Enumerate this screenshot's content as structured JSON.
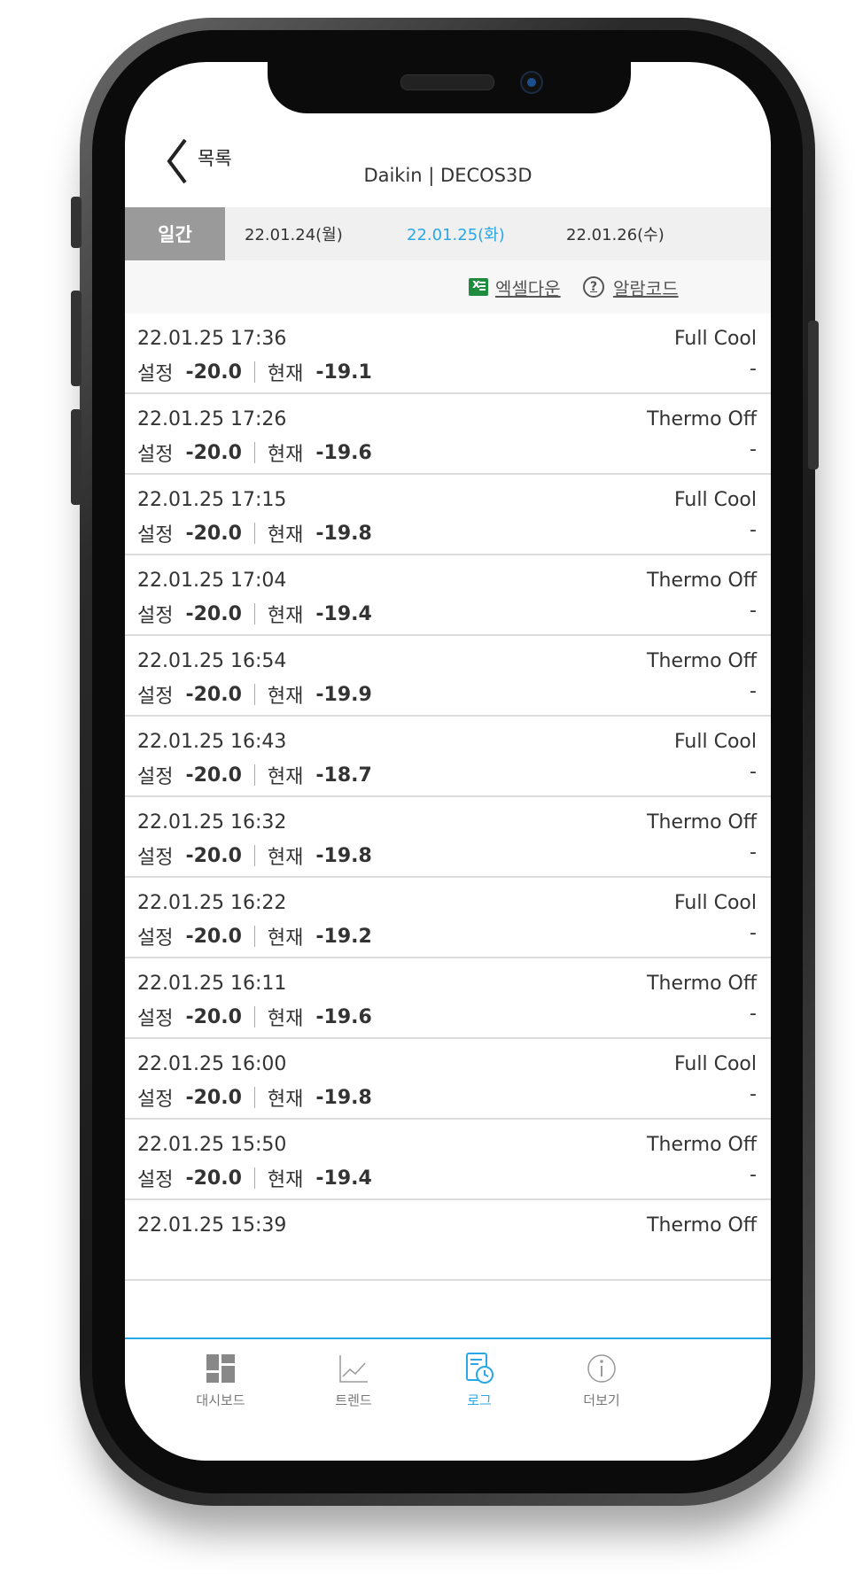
{
  "header": {
    "back_label": "목록",
    "title": "Daikin | DECOS3D"
  },
  "datebar": {
    "period_label": "일간",
    "dates": [
      "22.01.24(월)",
      "22.01.25(화)",
      "22.01.26(수)"
    ],
    "active_index": 1
  },
  "toolbar": {
    "excel_label": "엑셀다운",
    "alarm_label": "알람코드"
  },
  "labels": {
    "setpoint": "설정",
    "current": "현재"
  },
  "logs": [
    {
      "time": "22.01.25 17:36",
      "status": "Full Cool",
      "setpoint": "-20.0",
      "current": "-19.1",
      "alarm": "-"
    },
    {
      "time": "22.01.25 17:26",
      "status": "Thermo Off",
      "setpoint": "-20.0",
      "current": "-19.6",
      "alarm": "-"
    },
    {
      "time": "22.01.25 17:15",
      "status": "Full Cool",
      "setpoint": "-20.0",
      "current": "-19.8",
      "alarm": "-"
    },
    {
      "time": "22.01.25 17:04",
      "status": "Thermo Off",
      "setpoint": "-20.0",
      "current": "-19.4",
      "alarm": "-"
    },
    {
      "time": "22.01.25 16:54",
      "status": "Thermo Off",
      "setpoint": "-20.0",
      "current": "-19.9",
      "alarm": "-"
    },
    {
      "time": "22.01.25 16:43",
      "status": "Full Cool",
      "setpoint": "-20.0",
      "current": "-18.7",
      "alarm": "-"
    },
    {
      "time": "22.01.25 16:32",
      "status": "Thermo Off",
      "setpoint": "-20.0",
      "current": "-19.8",
      "alarm": "-"
    },
    {
      "time": "22.01.25 16:22",
      "status": "Full Cool",
      "setpoint": "-20.0",
      "current": "-19.2",
      "alarm": "-"
    },
    {
      "time": "22.01.25 16:11",
      "status": "Thermo Off",
      "setpoint": "-20.0",
      "current": "-19.6",
      "alarm": "-"
    },
    {
      "time": "22.01.25 16:00",
      "status": "Full Cool",
      "setpoint": "-20.0",
      "current": "-19.8",
      "alarm": "-"
    },
    {
      "time": "22.01.25 15:50",
      "status": "Thermo Off",
      "setpoint": "-20.0",
      "current": "-19.4",
      "alarm": "-"
    },
    {
      "time": "22.01.25 15:39",
      "status": "Thermo Off",
      "setpoint": "",
      "current": "",
      "alarm": ""
    }
  ],
  "nav": {
    "items": [
      "대시보드",
      "트렌드",
      "로그",
      "더보기"
    ],
    "active_index": 2
  },
  "colors": {
    "accent": "#2aa7e6",
    "excel": "#1f8b3c",
    "tab_bg": "#9a9a9a"
  }
}
